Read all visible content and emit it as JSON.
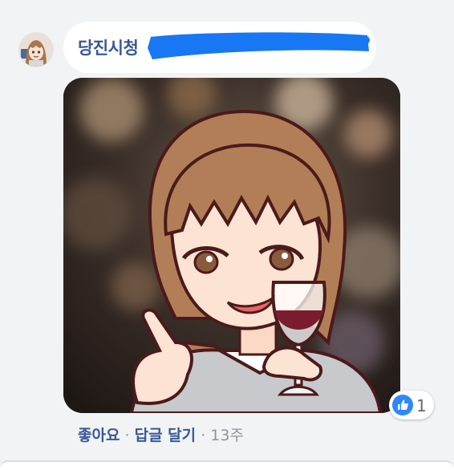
{
  "comment": {
    "author": "당진시청",
    "actions": {
      "like": "좋아요",
      "separator": "·",
      "reply": "답글 달기",
      "time": "13주"
    },
    "reactions": {
      "icon": "thumbs-up-icon",
      "count": "1",
      "color": "#2d88ff"
    }
  },
  "colors": {
    "link": "#385898",
    "background": "#f2f3f5",
    "redaction": "#1877f2"
  }
}
